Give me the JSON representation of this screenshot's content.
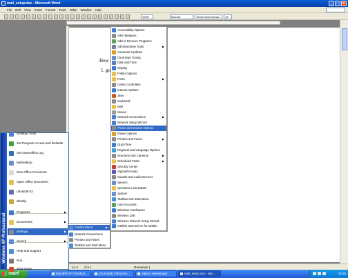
{
  "window": {
    "title": "mail_setup.doc - Microsoft Word",
    "buttons": [
      "_",
      "□",
      "x"
    ]
  },
  "menubar": [
    "File",
    "Edit",
    "View",
    "Insert",
    "Format",
    "Tools",
    "Table",
    "Window",
    "Help"
  ],
  "toolbar": {
    "zoom": "100%",
    "style": "Normal",
    "font": "Times New Roman",
    "size": "12"
  },
  "document": {
    "lines": [
      "How to",
      "1. go to"
    ]
  },
  "statusbar": {
    "ln": "Ln 4",
    "col": "Col 1",
    "language": "Romanian ("
  },
  "taskbar": {
    "start": "start",
    "tasks": [
      "EQUIPE.PH Postbuil...",
      "(3 unread) Yahoo! M...",
      "Yahoo! Messenger",
      "mail_setup.doc - Mic..."
    ],
    "clock": "16:55"
  },
  "startmenu": {
    "band": "Windows XP Professional",
    "items": [
      {
        "label": "Desktop Tools",
        "color": "#4a7fd1"
      },
      {
        "label": "Set Program Access and Defaults",
        "color": "#3f9e46"
      },
      {
        "label": "Get OpenOffice.org",
        "color": "#2f6fb5"
      },
      {
        "label": "MyDesktop",
        "color": "#6a8fc8"
      },
      {
        "label": "New Office Document",
        "color": "#d8d8d8"
      },
      {
        "label": "Open Office Document",
        "color": "#e6c24a"
      },
      {
        "label": "UltraEdit-32",
        "color": "#5a6fb0"
      },
      {
        "label": "WinZip",
        "color": "#c9a53a"
      },
      {
        "label": "Programs",
        "color": "#3a7bd5"
      },
      {
        "label": "Documents",
        "color": "#e8c552"
      },
      {
        "label": "Settings",
        "color": "#8a8a8a"
      },
      {
        "label": "Search",
        "color": "#5b8ad6"
      },
      {
        "label": "Help and Support",
        "color": "#4a90d9"
      },
      {
        "label": "Run...",
        "color": "#7b7b7b"
      },
      {
        "label": "Shut Down...",
        "color": "#d24a2a"
      }
    ]
  },
  "settings_menu": [
    {
      "label": "Control Panel",
      "color": "#5b8ad6"
    },
    {
      "label": "Network Connections",
      "color": "#4a7fd1"
    },
    {
      "label": "Printers and Faxes",
      "color": "#8a8a8a"
    },
    {
      "label": "Taskbar and Start Menu",
      "color": "#4a90d9"
    }
  ],
  "control_panel": [
    {
      "label": "Accessibility Options",
      "color": "#3b7ad0"
    },
    {
      "label": "Add Hardware",
      "color": "#8a8a8a"
    },
    {
      "label": "Add or Remove Programs",
      "color": "#5aa05a"
    },
    {
      "label": "Administrative Tools",
      "color": "#7a7a9a"
    },
    {
      "label": "Automatic Updates",
      "color": "#d8a030"
    },
    {
      "label": "ClearType Tuning",
      "color": "#6a8fc8"
    },
    {
      "label": "Date and Time",
      "color": "#5a7fc0"
    },
    {
      "label": "Display",
      "color": "#3b7ad0"
    },
    {
      "label": "Folder Options",
      "color": "#e6c24a"
    },
    {
      "label": "Fonts",
      "color": "#e6c24a"
    },
    {
      "label": "Game Controllers",
      "color": "#8a8a8a"
    },
    {
      "label": "Internet Options",
      "color": "#3b7ad0"
    },
    {
      "label": "Java",
      "color": "#c85a2a"
    },
    {
      "label": "Keyboard",
      "color": "#8a8a8a"
    },
    {
      "label": "Mail",
      "color": "#e6c24a"
    },
    {
      "label": "Mouse",
      "color": "#9a9a9a"
    },
    {
      "label": "Network Connections",
      "color": "#4a7fd1"
    },
    {
      "label": "Network Setup Wizard",
      "color": "#4a7fd1"
    },
    {
      "label": "Phone and Modem Options",
      "color": "#8a8a8a"
    },
    {
      "label": "Power Options",
      "color": "#d8a030"
    },
    {
      "label": "Printers and Faxes",
      "color": "#8a8a8a"
    },
    {
      "label": "QuickTime",
      "color": "#3b7ad0"
    },
    {
      "label": "Regional and Language Options",
      "color": "#3b9ad0"
    },
    {
      "label": "Scanners and Cameras",
      "color": "#8a8a8a"
    },
    {
      "label": "Scheduled Tasks",
      "color": "#e6c24a"
    },
    {
      "label": "Security Center",
      "color": "#c83a3a"
    },
    {
      "label": "SigmaTel Audio",
      "color": "#5a5ab0"
    },
    {
      "label": "Sounds and Audio Devices",
      "color": "#8a8a8a"
    },
    {
      "label": "Speech",
      "color": "#6a8fc8"
    },
    {
      "label": "Symantec LiveUpdate",
      "color": "#e6c24a"
    },
    {
      "label": "System",
      "color": "#6a8fc8"
    },
    {
      "label": "Taskbar and Start Menu",
      "color": "#4a90d9"
    },
    {
      "label": "User Accounts",
      "color": "#5aa05a"
    },
    {
      "label": "Windows CardSpace",
      "color": "#3b7ad0"
    },
    {
      "label": "Wireless Link",
      "color": "#8a8a8a"
    },
    {
      "label": "Wireless Network Setup Wizard",
      "color": "#4a7fd1"
    },
    {
      "label": "Intel(R) GMA Driver for Mobile",
      "color": "#3b7ad0"
    }
  ]
}
